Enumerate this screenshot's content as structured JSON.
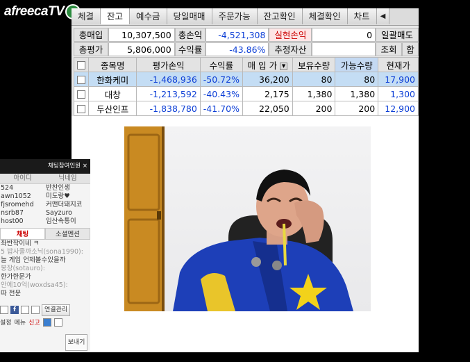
{
  "logo": "afreecaTV",
  "tabs": [
    "체결",
    "잔고",
    "예수금",
    "당일매매",
    "주문가능",
    "잔고확인",
    "체결확인",
    "차트",
    "◀"
  ],
  "summary": {
    "row1": {
      "buy_label": "총매입",
      "buy_value": "10,307,500",
      "loss_label": "총손익",
      "loss_value": "-4,521,308",
      "realized_label": "실현손익",
      "realized_value": "0",
      "bulk_label": "일괄매도"
    },
    "row2": {
      "eval_label": "총평가",
      "eval_value": "5,806,000",
      "rate_label": "수익률",
      "rate_value": "-43.86%",
      "est_label": "추정자산",
      "query_label": "조회",
      "sum_label": "합"
    }
  },
  "table": {
    "headers": [
      "종목명",
      "평가손익",
      "수익률",
      "매 입 가",
      "보유수량",
      "가능수량",
      "현재가"
    ],
    "rows": [
      {
        "name": "한화케미",
        "pl": "-1,468,936",
        "rate": "-50.72%",
        "buy": "36,200",
        "hold": "80",
        "avail": "80",
        "price": "17,900"
      },
      {
        "name": "대창",
        "pl": "-1,213,592",
        "rate": "-40.43%",
        "buy": "2,175",
        "hold": "1,380",
        "avail": "1,380",
        "price": "1,300"
      },
      {
        "name": "두산인프",
        "pl": "-1,838,780",
        "rate": "-41.70%",
        "buy": "22,050",
        "hold": "200",
        "avail": "200",
        "price": "12,900"
      }
    ]
  },
  "chat": {
    "header": "채팅참여인원",
    "close": "×",
    "col_id": "아이디",
    "col_nick": "닉네임",
    "users": [
      {
        "id": "524",
        "nick": "반찬인생"
      },
      {
        "id": "awn1052",
        "nick": "미도랑♥"
      },
      {
        "id": "fjsromehd",
        "nick": "커맨더돼지코"
      },
      {
        "id": "nsrb87",
        "nick": "Sayzuro"
      },
      {
        "id": "host00",
        "nick": "임산속통이"
      }
    ],
    "tab_chat": "채팅",
    "tab_notice": "소셜멘션",
    "messages": [
      {
        "text": "좌반작이네 ㅋ",
        "nick": false
      },
      {
        "text": "5 밥사줄까소닉(sona1990):",
        "nick": true
      },
      {
        "text": "늘 게임 언제볼수있을까",
        "nick": false
      },
      {
        "text": "봉장(sotauro):",
        "nick": true
      },
      {
        "text": "한가한문가",
        "nick": false
      },
      {
        "text": "안에10억(woxdsa45):",
        "nick": true
      },
      {
        "text": "따 전문",
        "nick": false
      }
    ],
    "link_manage": "연결관리",
    "settings": "설정",
    "menu": "메뉴",
    "report": "신고",
    "send": "보내기"
  },
  "colors": {
    "accent_blue": "#0d3fd6",
    "loss_red": "#d40000",
    "selected_row": "#c4ddf4"
  }
}
